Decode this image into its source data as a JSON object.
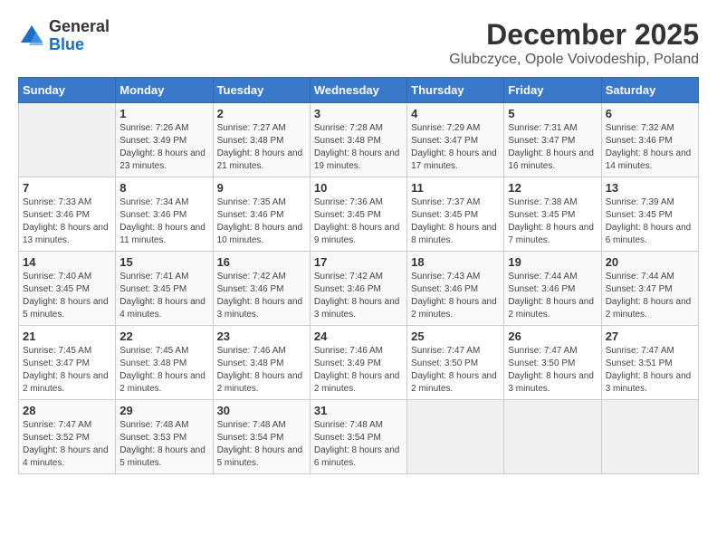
{
  "logo": {
    "general": "General",
    "blue": "Blue"
  },
  "header": {
    "month": "December 2025",
    "location": "Glubczyce, Opole Voivodeship, Poland"
  },
  "weekdays": [
    "Sunday",
    "Monday",
    "Tuesday",
    "Wednesday",
    "Thursday",
    "Friday",
    "Saturday"
  ],
  "weeks": [
    [
      {
        "day": "",
        "sunrise": "",
        "sunset": "",
        "daylight": ""
      },
      {
        "day": "1",
        "sunrise": "Sunrise: 7:26 AM",
        "sunset": "Sunset: 3:49 PM",
        "daylight": "Daylight: 8 hours and 23 minutes."
      },
      {
        "day": "2",
        "sunrise": "Sunrise: 7:27 AM",
        "sunset": "Sunset: 3:48 PM",
        "daylight": "Daylight: 8 hours and 21 minutes."
      },
      {
        "day": "3",
        "sunrise": "Sunrise: 7:28 AM",
        "sunset": "Sunset: 3:48 PM",
        "daylight": "Daylight: 8 hours and 19 minutes."
      },
      {
        "day": "4",
        "sunrise": "Sunrise: 7:29 AM",
        "sunset": "Sunset: 3:47 PM",
        "daylight": "Daylight: 8 hours and 17 minutes."
      },
      {
        "day": "5",
        "sunrise": "Sunrise: 7:31 AM",
        "sunset": "Sunset: 3:47 PM",
        "daylight": "Daylight: 8 hours and 16 minutes."
      },
      {
        "day": "6",
        "sunrise": "Sunrise: 7:32 AM",
        "sunset": "Sunset: 3:46 PM",
        "daylight": "Daylight: 8 hours and 14 minutes."
      }
    ],
    [
      {
        "day": "7",
        "sunrise": "Sunrise: 7:33 AM",
        "sunset": "Sunset: 3:46 PM",
        "daylight": "Daylight: 8 hours and 13 minutes."
      },
      {
        "day": "8",
        "sunrise": "Sunrise: 7:34 AM",
        "sunset": "Sunset: 3:46 PM",
        "daylight": "Daylight: 8 hours and 11 minutes."
      },
      {
        "day": "9",
        "sunrise": "Sunrise: 7:35 AM",
        "sunset": "Sunset: 3:46 PM",
        "daylight": "Daylight: 8 hours and 10 minutes."
      },
      {
        "day": "10",
        "sunrise": "Sunrise: 7:36 AM",
        "sunset": "Sunset: 3:45 PM",
        "daylight": "Daylight: 8 hours and 9 minutes."
      },
      {
        "day": "11",
        "sunrise": "Sunrise: 7:37 AM",
        "sunset": "Sunset: 3:45 PM",
        "daylight": "Daylight: 8 hours and 8 minutes."
      },
      {
        "day": "12",
        "sunrise": "Sunrise: 7:38 AM",
        "sunset": "Sunset: 3:45 PM",
        "daylight": "Daylight: 8 hours and 7 minutes."
      },
      {
        "day": "13",
        "sunrise": "Sunrise: 7:39 AM",
        "sunset": "Sunset: 3:45 PM",
        "daylight": "Daylight: 8 hours and 6 minutes."
      }
    ],
    [
      {
        "day": "14",
        "sunrise": "Sunrise: 7:40 AM",
        "sunset": "Sunset: 3:45 PM",
        "daylight": "Daylight: 8 hours and 5 minutes."
      },
      {
        "day": "15",
        "sunrise": "Sunrise: 7:41 AM",
        "sunset": "Sunset: 3:45 PM",
        "daylight": "Daylight: 8 hours and 4 minutes."
      },
      {
        "day": "16",
        "sunrise": "Sunrise: 7:42 AM",
        "sunset": "Sunset: 3:46 PM",
        "daylight": "Daylight: 8 hours and 3 minutes."
      },
      {
        "day": "17",
        "sunrise": "Sunrise: 7:42 AM",
        "sunset": "Sunset: 3:46 PM",
        "daylight": "Daylight: 8 hours and 3 minutes."
      },
      {
        "day": "18",
        "sunrise": "Sunrise: 7:43 AM",
        "sunset": "Sunset: 3:46 PM",
        "daylight": "Daylight: 8 hours and 2 minutes."
      },
      {
        "day": "19",
        "sunrise": "Sunrise: 7:44 AM",
        "sunset": "Sunset: 3:46 PM",
        "daylight": "Daylight: 8 hours and 2 minutes."
      },
      {
        "day": "20",
        "sunrise": "Sunrise: 7:44 AM",
        "sunset": "Sunset: 3:47 PM",
        "daylight": "Daylight: 8 hours and 2 minutes."
      }
    ],
    [
      {
        "day": "21",
        "sunrise": "Sunrise: 7:45 AM",
        "sunset": "Sunset: 3:47 PM",
        "daylight": "Daylight: 8 hours and 2 minutes."
      },
      {
        "day": "22",
        "sunrise": "Sunrise: 7:45 AM",
        "sunset": "Sunset: 3:48 PM",
        "daylight": "Daylight: 8 hours and 2 minutes."
      },
      {
        "day": "23",
        "sunrise": "Sunrise: 7:46 AM",
        "sunset": "Sunset: 3:48 PM",
        "daylight": "Daylight: 8 hours and 2 minutes."
      },
      {
        "day": "24",
        "sunrise": "Sunrise: 7:46 AM",
        "sunset": "Sunset: 3:49 PM",
        "daylight": "Daylight: 8 hours and 2 minutes."
      },
      {
        "day": "25",
        "sunrise": "Sunrise: 7:47 AM",
        "sunset": "Sunset: 3:50 PM",
        "daylight": "Daylight: 8 hours and 2 minutes."
      },
      {
        "day": "26",
        "sunrise": "Sunrise: 7:47 AM",
        "sunset": "Sunset: 3:50 PM",
        "daylight": "Daylight: 8 hours and 3 minutes."
      },
      {
        "day": "27",
        "sunrise": "Sunrise: 7:47 AM",
        "sunset": "Sunset: 3:51 PM",
        "daylight": "Daylight: 8 hours and 3 minutes."
      }
    ],
    [
      {
        "day": "28",
        "sunrise": "Sunrise: 7:47 AM",
        "sunset": "Sunset: 3:52 PM",
        "daylight": "Daylight: 8 hours and 4 minutes."
      },
      {
        "day": "29",
        "sunrise": "Sunrise: 7:48 AM",
        "sunset": "Sunset: 3:53 PM",
        "daylight": "Daylight: 8 hours and 5 minutes."
      },
      {
        "day": "30",
        "sunrise": "Sunrise: 7:48 AM",
        "sunset": "Sunset: 3:54 PM",
        "daylight": "Daylight: 8 hours and 5 minutes."
      },
      {
        "day": "31",
        "sunrise": "Sunrise: 7:48 AM",
        "sunset": "Sunset: 3:54 PM",
        "daylight": "Daylight: 8 hours and 6 minutes."
      },
      {
        "day": "",
        "sunrise": "",
        "sunset": "",
        "daylight": ""
      },
      {
        "day": "",
        "sunrise": "",
        "sunset": "",
        "daylight": ""
      },
      {
        "day": "",
        "sunrise": "",
        "sunset": "",
        "daylight": ""
      }
    ]
  ]
}
